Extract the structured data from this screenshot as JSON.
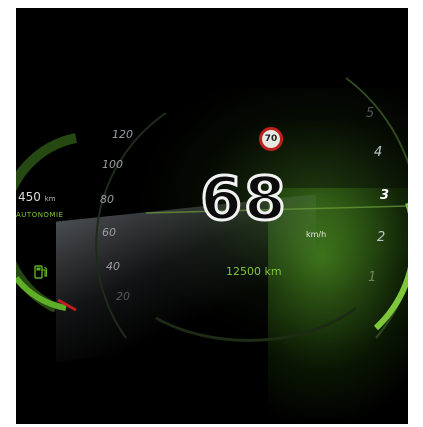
{
  "speed_limit": "70",
  "speed": "68",
  "speed_unit": "km/h",
  "odometer": "12500 km",
  "range_value": "450",
  "range_unit": "km",
  "range_label": "AUTONOMIE",
  "speed_ticks": [
    "120",
    "100",
    "80",
    "60",
    "40",
    "20"
  ],
  "gears": [
    "5",
    "4",
    "3",
    "2",
    "1"
  ],
  "active_gear": "3",
  "colors": {
    "accent_green": "#7ec63a",
    "limit_red": "#c0201c",
    "background": "#000000"
  },
  "icons": {
    "fuel": "fuel-pump-icon"
  }
}
